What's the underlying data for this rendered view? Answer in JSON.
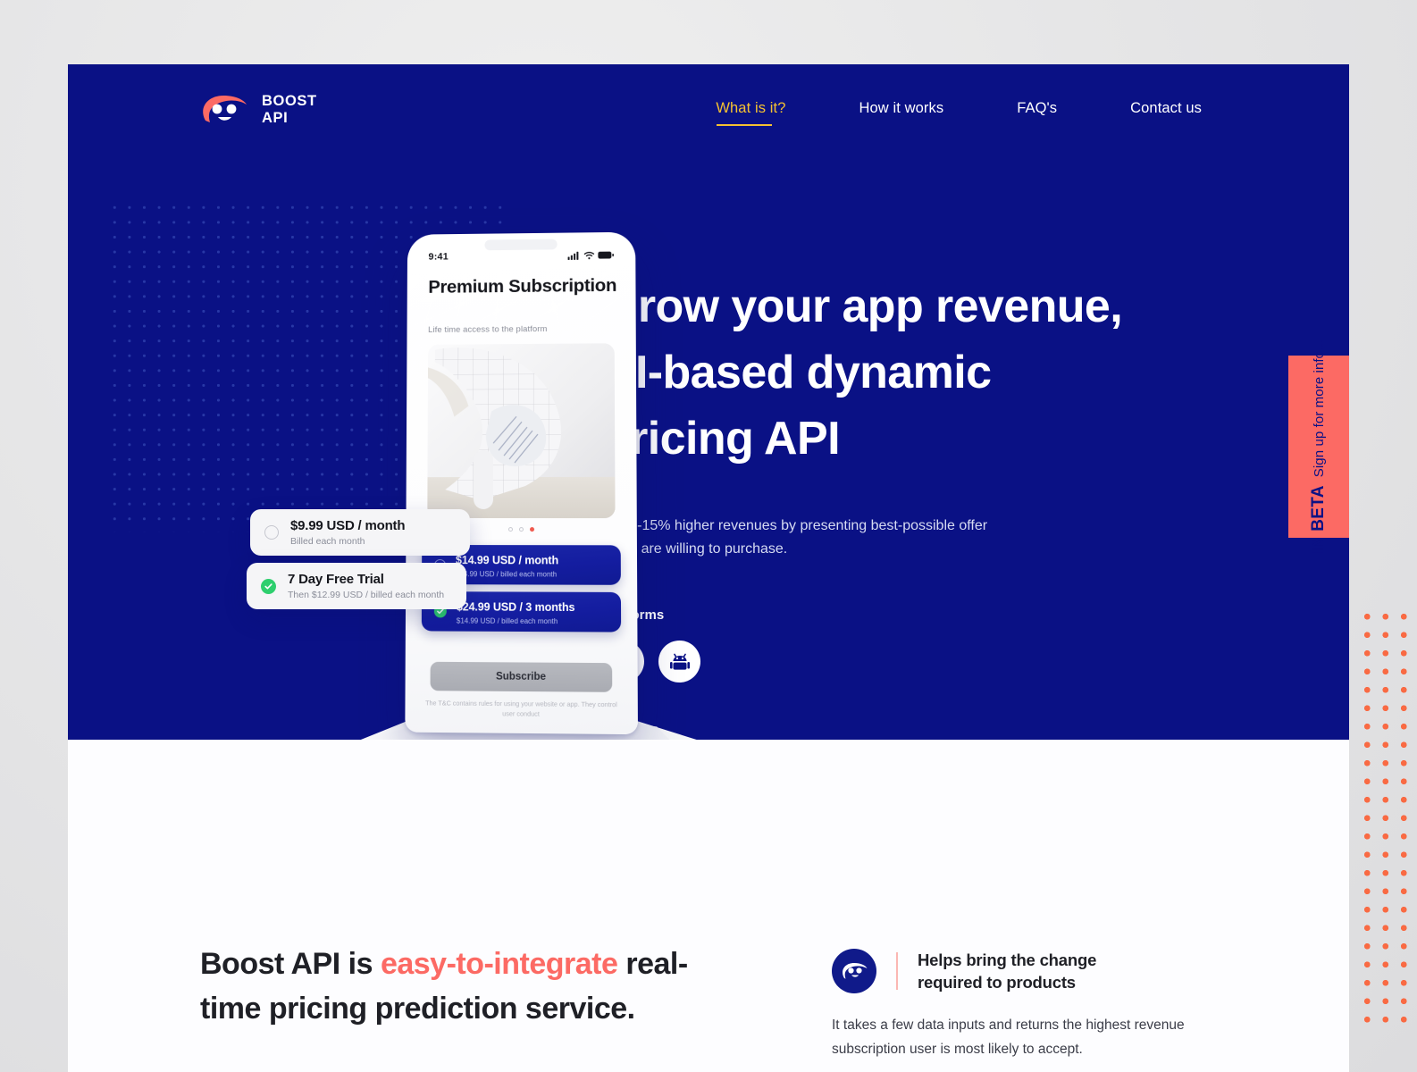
{
  "brand": {
    "line1": "BOOST",
    "line2": "API",
    "logo_icon": "boost-face-logo-icon"
  },
  "nav": {
    "items": [
      {
        "label": "What is it?",
        "active": true
      },
      {
        "label": "How it works",
        "active": false
      },
      {
        "label": "FAQ's",
        "active": false
      },
      {
        "label": "Contact us",
        "active": false
      }
    ]
  },
  "hero": {
    "headline_line1": "Grow your app revenue,",
    "headline_line2": "AI-based dynamic",
    "headline_line3": "pricing API",
    "subtext": "Get 5-15% higher revenues by presenting best-possible offer users are willing to purchase.",
    "platforms_label": "Platforms",
    "platforms": [
      {
        "name": "apple-icon",
        "label": "iOS"
      },
      {
        "name": "android-icon",
        "label": "Android"
      }
    ]
  },
  "beta_badge": {
    "title": "IN BETA",
    "subtitle": "Sign up for more info...",
    "color": "#fc6a64"
  },
  "phone": {
    "status_time": "9:41",
    "status_icons": [
      "cellular-signal-icon",
      "wifi-icon",
      "battery-icon"
    ],
    "title": "Premium Subscription",
    "subtitle": "Life time access to the platform",
    "carousel_dots": 3,
    "carousel_active_index": 2,
    "plans": [
      {
        "title": "$14.99 USD / month",
        "sub": "$14.99 USD / billed each month",
        "selected": false
      },
      {
        "title": "$24.99 USD / 3 months",
        "sub": "$14.99 USD / billed each month",
        "selected": true
      }
    ],
    "subscribe_label": "Subscribe",
    "tc_note": "The T&C contains rules for using your website or app. They control user conduct"
  },
  "floating_cards": [
    {
      "title": "$9.99 USD / month",
      "sub": "Billed each month",
      "selected": false
    },
    {
      "title": "7 Day Free Trial",
      "sub": "Then $12.99 USD / billed each month",
      "selected": true
    }
  ],
  "lower": {
    "heading_pre": "Boost API is ",
    "heading_highlight": "easy-to-integrate",
    "heading_post": " real-time pricing prediction service.",
    "feature": {
      "icon": "boost-face-circle-icon",
      "title_line1": "Helps bring the change",
      "title_line2": "required to products",
      "body": "It takes a few data inputs and returns the highest revenue subscription user is most likely to accept."
    }
  },
  "colors": {
    "brand_blue": "#0a1185",
    "accent_coral": "#fc6a64",
    "accent_yellow": "#f5c131",
    "success_green": "#2ecf6e",
    "page_bg": "#fdfdff",
    "outer_bg": "#e6e6e7"
  }
}
